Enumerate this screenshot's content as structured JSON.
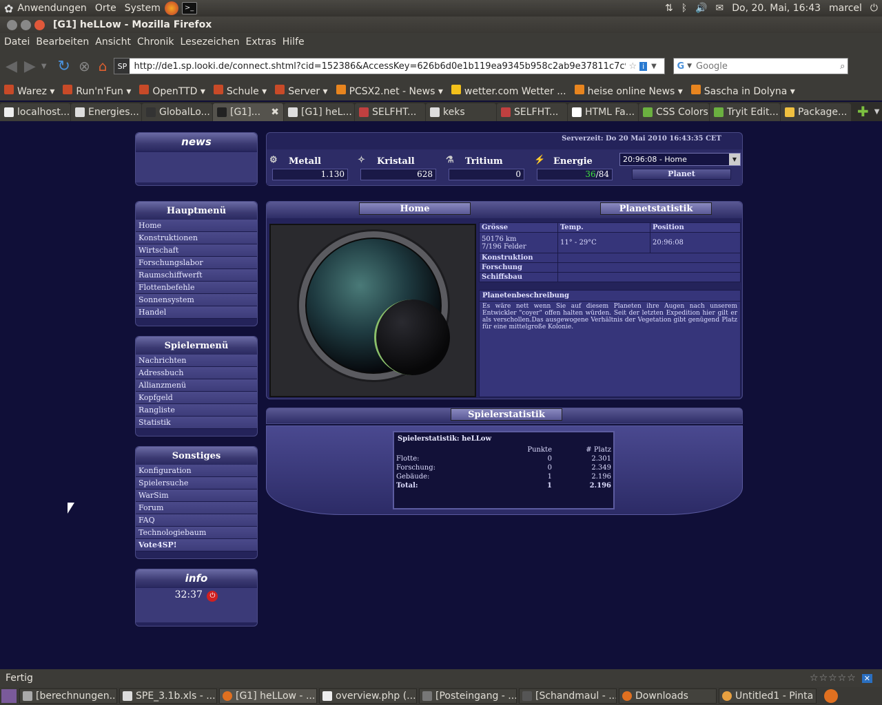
{
  "topbar": {
    "apps": "Anwendungen",
    "places": "Orte",
    "system": "System",
    "datetime": "Do, 20. Mai, 16:43",
    "user": "marcel"
  },
  "window": {
    "title": "[G1] heLLow - Mozilla Firefox"
  },
  "menubar": [
    "Datei",
    "Bearbeiten",
    "Ansicht",
    "Chronik",
    "Lesezeichen",
    "Extras",
    "Hilfe"
  ],
  "nav": {
    "url": "http://de1.sp.looki.de/connect.shtml?cid=152386&AccessKey=626b6d0e1b119ea9345b958c2ab9e37811c7c94",
    "search_placeholder": "Google"
  },
  "bookmarks": [
    "Warez ▾",
    "Run'n'Fun ▾",
    "OpenTTD ▾",
    "Schule ▾",
    "Server ▾",
    "PCSX2.net - News ▾",
    "wetter.com Wetter ...",
    "heise online News ▾",
    "Sascha in Dolyna ▾"
  ],
  "tabs": [
    "localhost...",
    "Energies...",
    "GlobalLo...",
    "[G1]...",
    "[G1] heL...",
    "SELFHT...",
    "keks",
    "SELFHT...",
    "HTML Fa...",
    "CSS Colors",
    "Tryit Edit...",
    "Package..."
  ],
  "game": {
    "news_title": "news",
    "servertime": "Serverzeit: Do 20 Mai 2010 16:43:35 CET",
    "resources": [
      {
        "name": "Metall",
        "value": "1.130"
      },
      {
        "name": "Kristall",
        "value": "628"
      },
      {
        "name": "Tritium",
        "value": "0"
      },
      {
        "name": "Energie",
        "value_used": "36",
        "value_total": "/84"
      }
    ],
    "planet_select": "20:96:08 - Home",
    "planet_label": "Planet",
    "mainmenu": {
      "title": "Hauptmenü",
      "items": [
        "Home",
        "Konstruktionen",
        "Wirtschaft",
        "Forschungslabor",
        "Raumschiffwerft",
        "Flottenbefehle",
        "Sonnensystem",
        "Handel"
      ]
    },
    "playermenu": {
      "title": "Spielermenü",
      "items": [
        "Nachrichten",
        "Adressbuch",
        "Allianzmenü",
        "Kopfgeld",
        "Rangliste",
        "Statistik"
      ]
    },
    "misc": {
      "title": "Sonstiges",
      "items": [
        "Konfiguration",
        "Spielersuche",
        "WarSim",
        "Forum",
        "FAQ",
        "Technologiebaum",
        "Vote4SP!"
      ]
    },
    "info": {
      "title": "info",
      "time": "32:37"
    },
    "tabs": {
      "home": "Home",
      "planetstat": "Planetstatistik"
    },
    "planet": {
      "h_size": "Grösse",
      "h_temp": "Temp.",
      "h_pos": "Position",
      "size": "50176 km",
      "fields": "7/196 Felder",
      "temp": "11° - 29°C",
      "pos": "20:96:08",
      "konstruktion": "Konstruktion",
      "forschung": "Forschung",
      "schiffsbau": "Schiffsbau",
      "desc_title": "Planetenbeschreibung",
      "desc": "Es wäre nett wenn Sie auf diesem Planeten ihre Augen nach unserem Entwickler \"coyer\" offen halten würden. Seit der letzten Expedition hier gilt er als verschollen.Das ausgewogene Verhältnis der Vegetation gibt genügend Platz für eine mittelgroße Kolonie."
    },
    "playerstats": {
      "header": "Spielerstatistik",
      "title": "Spielerstatistik: heLLow",
      "col_points": "Punkte",
      "col_rank": "# Platz",
      "rows": [
        {
          "label": "Flotte:",
          "points": "0",
          "rank": "2.301"
        },
        {
          "label": "Forschung:",
          "points": "0",
          "rank": "2.349"
        },
        {
          "label": "Gebäude:",
          "points": "1",
          "rank": "2.196"
        },
        {
          "label": "Total:",
          "points": "1",
          "rank": "2.196"
        }
      ]
    }
  },
  "status": "Fertig",
  "taskbar": [
    "[berechnungen...",
    "SPE_3.1b.xls - ...",
    "[G1] heLLow - ...",
    "overview.php (...",
    "[Posteingang - ...",
    "[Schandmaul - ...",
    "Downloads",
    "Untitled1 - Pinta"
  ]
}
